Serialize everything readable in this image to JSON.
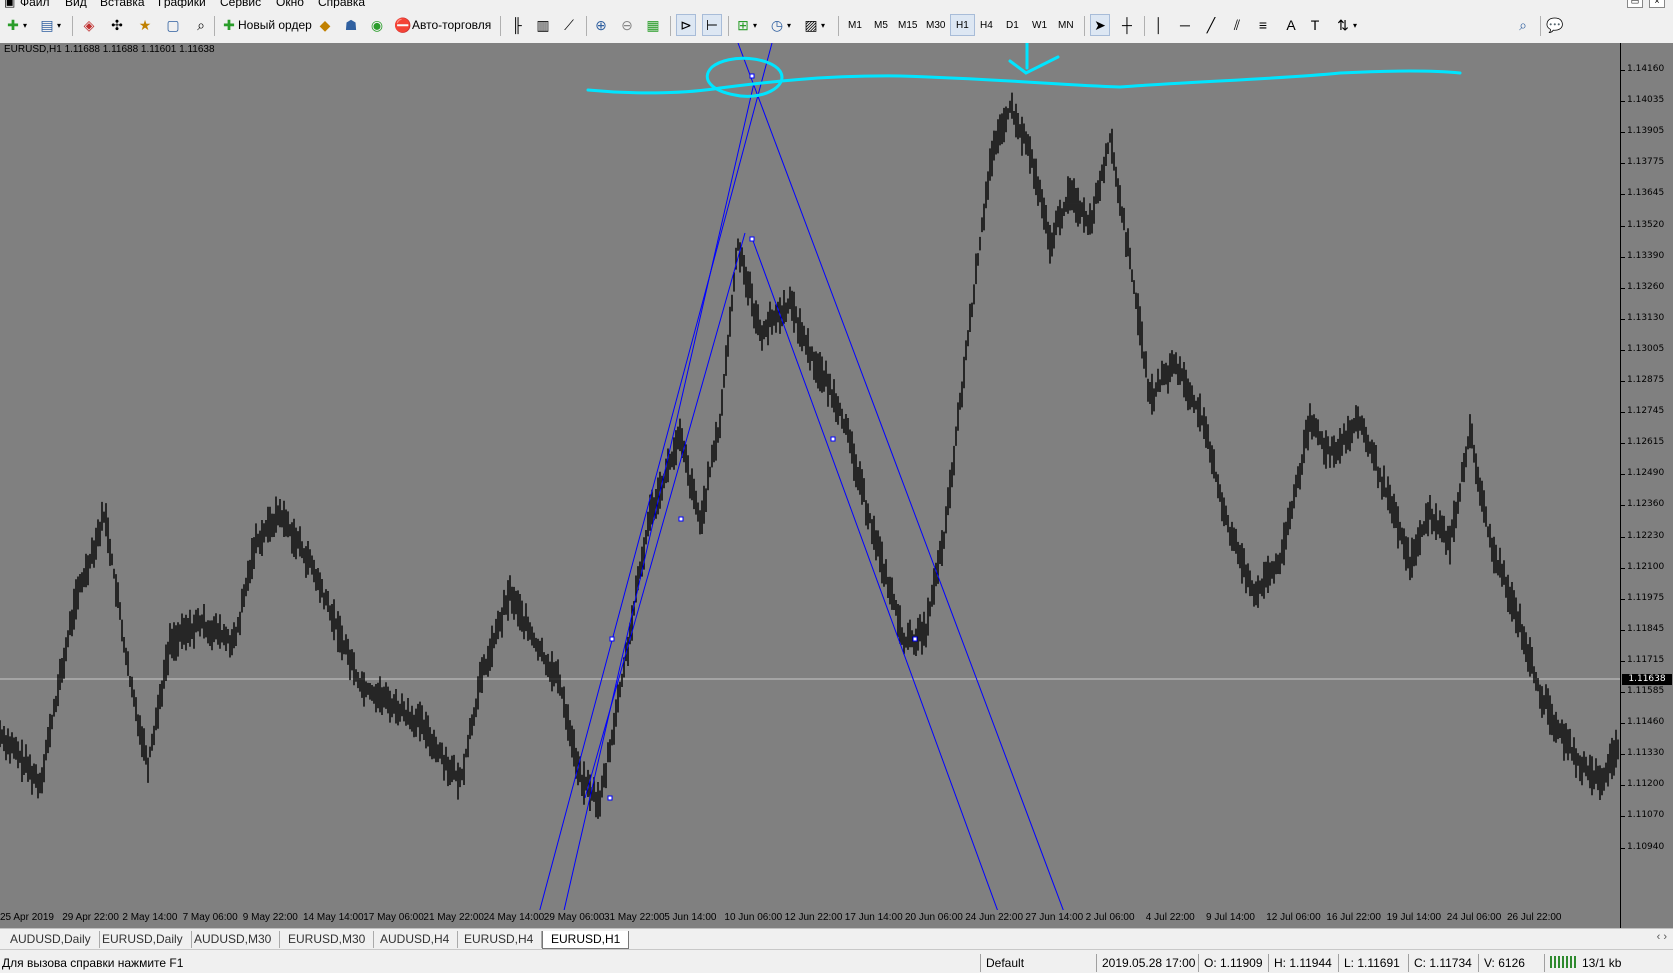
{
  "menu": {
    "items": [
      "Файл",
      "Вид",
      "Вставка",
      "Графики",
      "Сервис",
      "Окно",
      "Справка"
    ]
  },
  "toolbar": {
    "new_order_label": "Новый ордер",
    "autotrading_label": "Авто-торговля",
    "timeframes": [
      "M1",
      "M5",
      "M15",
      "M30",
      "H1",
      "H4",
      "D1",
      "W1",
      "MN"
    ],
    "active_timeframe": "H1",
    "icons": [
      "new-chart-icon",
      "profiles-icon",
      "market-watch-icon",
      "navigator-icon",
      "data-window-icon",
      "terminal-icon",
      "strategy-tester-icon",
      "metaeditor-icon",
      "signals-icon",
      "bar-chart-icon",
      "candlestick-icon",
      "line-chart-icon",
      "zoom-in-icon",
      "zoom-out-icon",
      "tile-windows-icon",
      "autoscroll-icon",
      "chart-shift-icon",
      "indicators-icon",
      "periods-icon",
      "templates-icon",
      "cursor-icon",
      "crosshair-icon",
      "vertical-line-icon",
      "horizontal-line-icon",
      "trendline-icon",
      "equidistant-channel-icon",
      "fibonacci-icon",
      "text-icon",
      "text-label-icon",
      "arrows-icon",
      "search-icon",
      "chat-icon"
    ]
  },
  "chart": {
    "title": "EURUSD,H1  1.11688 1.11688 1.11601 1.11638",
    "symbol": "EURUSD",
    "timeframe": "H1",
    "background_color": "#808080",
    "candle_color": "#000000",
    "trendline_color": "#0000ff",
    "drawing_color": "#00e5ff",
    "current_price": "1.11638",
    "price_labels": [
      "1.14160",
      "1.14035",
      "1.13905",
      "1.13775",
      "1.13645",
      "1.13520",
      "1.13390",
      "1.13260",
      "1.13130",
      "1.13005",
      "1.12875",
      "1.12745",
      "1.12615",
      "1.12490",
      "1.12360",
      "1.12230",
      "1.12100",
      "1.11975",
      "1.11845",
      "1.11715",
      "1.11585",
      "1.11460",
      "1.11330",
      "1.11200",
      "1.11070",
      "1.10940"
    ],
    "time_labels": [
      "25 Apr 2019",
      "29 Apr 22:00",
      "2 May 14:00",
      "7 May 06:00",
      "9 May 22:00",
      "14 May 14:00",
      "17 May 06:00",
      "21 May 22:00",
      "24 May 14:00",
      "29 May 06:00",
      "31 May 22:00",
      "5 Jun 14:00",
      "10 Jun 06:00",
      "12 Jun 22:00",
      "17 Jun 14:00",
      "20 Jun 06:00",
      "24 Jun 22:00",
      "27 Jun 14:00",
      "2 Jul 06:00",
      "4 Jul 22:00",
      "9 Jul 14:00",
      "12 Jul 06:00",
      "16 Jul 22:00",
      "19 Jul 14:00",
      "24 Jul 06:00",
      "26 Jul 22:00"
    ]
  },
  "tabs": {
    "items": [
      "AUDUSD,Daily",
      "EURUSD,Daily",
      "AUDUSD,M30",
      "EURUSD,M30",
      "AUDUSD,H4",
      "EURUSD,H4",
      "EURUSD,H1"
    ],
    "active": "EURUSD,H1",
    "scroll_arrows": "‹ ›"
  },
  "status": {
    "help_text": "Для вызова справки нажмите F1",
    "profile": "Default",
    "datetime": "2019.05.28 17:00",
    "open": "O: 1.11909",
    "high": "H: 1.11944",
    "low": "L: 1.11691",
    "close": "C: 1.11734",
    "volume": "V: 6126",
    "traffic": "13/1 kb"
  }
}
